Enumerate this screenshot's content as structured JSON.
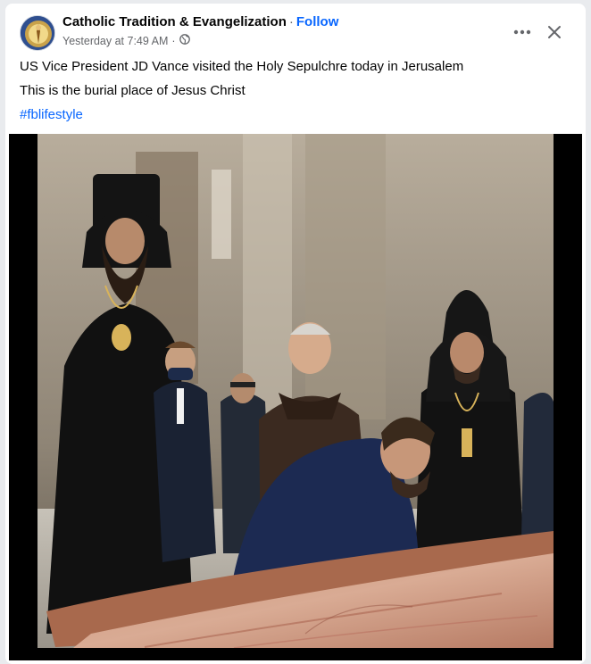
{
  "post": {
    "page_name": "Catholic Tradition & Evangelization",
    "separator": "·",
    "follow_label": "Follow",
    "timestamp": "Yesterday at 7:49 AM",
    "meta_separator": "·",
    "audience_icon": "globe-icon",
    "more_icon": "more-options-icon",
    "close_icon": "close-icon",
    "text_lines": [
      "US Vice President JD Vance visited the Holy Sepulchre today in Jerusalem",
      "This is the burial place of Jesus Christ"
    ],
    "hashtag": "#fblifestyle"
  },
  "colors": {
    "link": "#0866ff",
    "secondary_text": "#65676b",
    "primary_text": "#050505",
    "card": "#ffffff"
  }
}
